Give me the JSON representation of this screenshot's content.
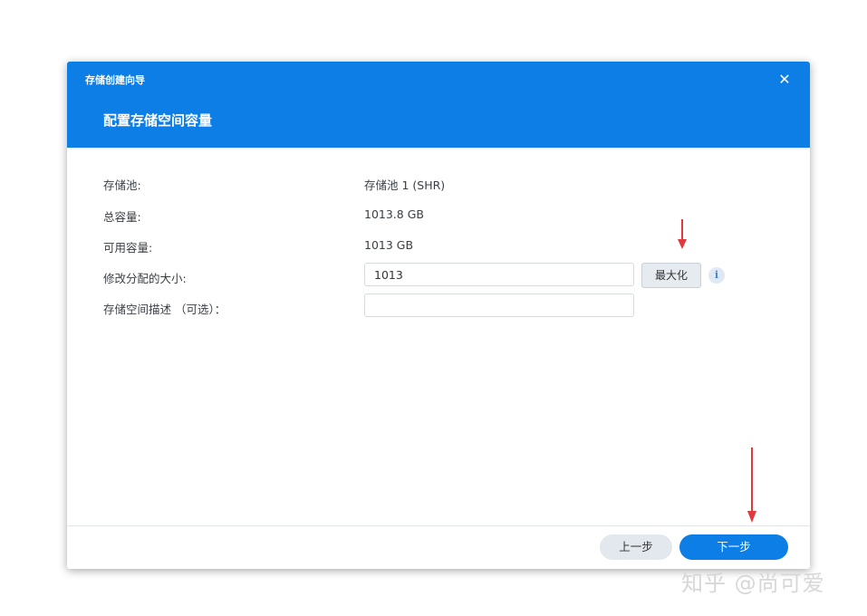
{
  "dialog": {
    "wizard_title": "存储创建向导",
    "close_glyph": "✕",
    "step_title": "配置存储空间容量"
  },
  "rows": {
    "pool_label": "存储池:",
    "pool_value": "存储池 1 (SHR)",
    "total_label": "总容量:",
    "total_value": "1013.8 GB",
    "available_label": "可用容量:",
    "available_value": "1013 GB",
    "size_label": "修改分配的大小:",
    "size_value": "1013",
    "desc_label": "存储空间描述 （可选）："
  },
  "buttons": {
    "maximize": "最大化",
    "info_glyph": "i",
    "prev": "上一步",
    "next": "下一步"
  },
  "colors": {
    "accent": "#0d7ee6",
    "annotation_arrow": "#e0393e"
  },
  "watermark": "知乎 @尚可爱"
}
